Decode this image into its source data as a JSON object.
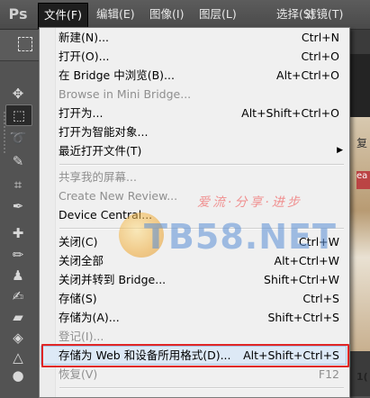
{
  "app": {
    "logo": "Ps"
  },
  "menubar": {
    "items": [
      {
        "label": "文件(F)"
      },
      {
        "label": "编辑(E)"
      },
      {
        "label": "图像(I)"
      },
      {
        "label": "图层(L)"
      },
      {
        "label": "选择(S)"
      },
      {
        "label": "滤镜(T)"
      }
    ]
  },
  "file_menu": {
    "items": [
      {
        "label": "新建(N)...",
        "shortcut": "Ctrl+N"
      },
      {
        "label": "打开(O)...",
        "shortcut": "Ctrl+O"
      },
      {
        "label": "在 Bridge 中浏览(B)...",
        "shortcut": "Alt+Ctrl+O"
      },
      {
        "label": "Browse in Mini Bridge..."
      },
      {
        "label": "打开为...",
        "shortcut": "Alt+Shift+Ctrl+O"
      },
      {
        "label": "打开为智能对象..."
      },
      {
        "label": "最近打开文件(T)",
        "arrow": "▶"
      },
      {
        "label": "共享我的屏幕..."
      },
      {
        "label": "Create New Review..."
      },
      {
        "label": "Device Central..."
      },
      {
        "label": "关闭(C)",
        "shortcut": "Ctrl+W"
      },
      {
        "label": "关闭全部",
        "shortcut": "Alt+Ctrl+W"
      },
      {
        "label": "关闭并转到 Bridge...",
        "shortcut": "Shift+Ctrl+W"
      },
      {
        "label": "存储(S)",
        "shortcut": "Ctrl+S"
      },
      {
        "label": "存储为(A)...",
        "shortcut": "Shift+Ctrl+S"
      },
      {
        "label": "登记(I)..."
      },
      {
        "label": "存储为 Web 和设备所用格式(D)...",
        "shortcut": "Alt+Shift+Ctrl+S"
      },
      {
        "label": "恢复(V)",
        "shortcut": "F12"
      }
    ]
  },
  "watermark": {
    "slogan": "爱流·分享·进步",
    "site": "TB58.NET"
  },
  "canvas": {
    "char": "复",
    "red_text": "ea",
    "bottom_text": "1("
  },
  "colors": {
    "highlight_border": "#e02626",
    "menu_bg": "#f0f0f0",
    "app_bg": "#535353"
  }
}
